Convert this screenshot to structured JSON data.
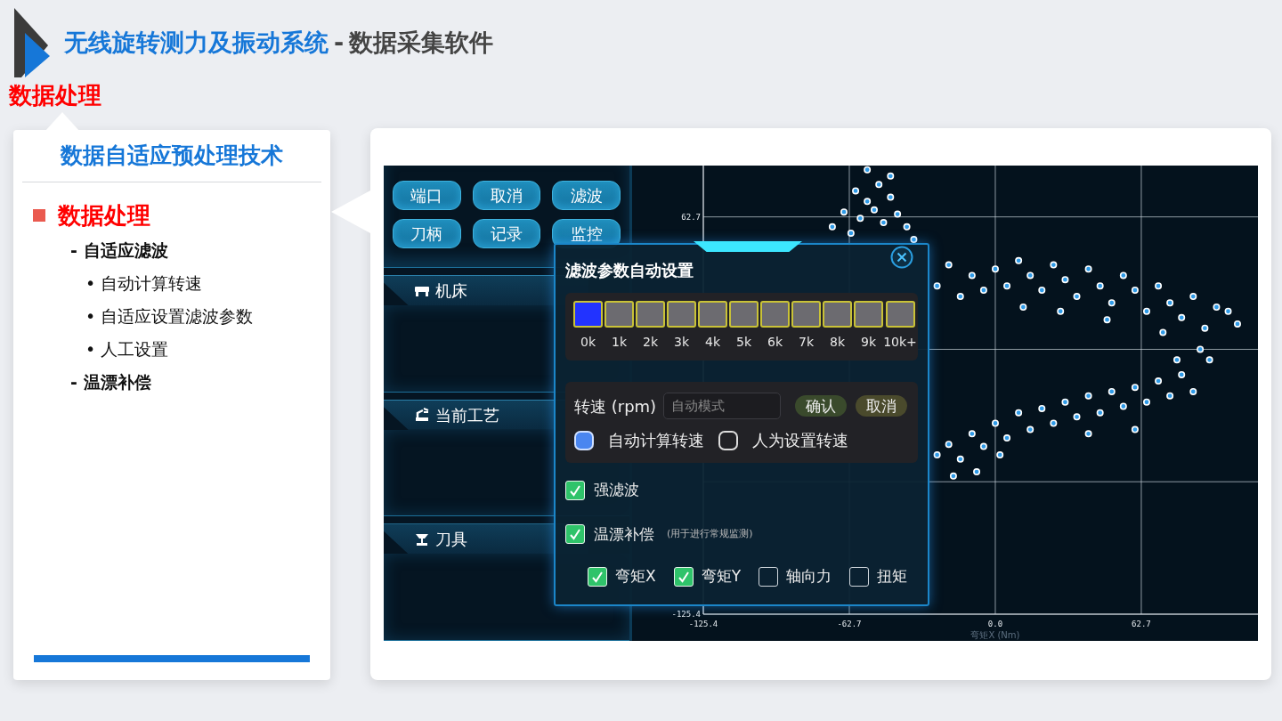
{
  "header": {
    "title_main": "无线旋转测力及振动系统",
    "title_separator": "-",
    "title_sub": "数据采集软件",
    "section": "数据处理"
  },
  "outline": {
    "title": "数据自适应预处理技术",
    "items": [
      {
        "text": "数据处理",
        "children": [
          {
            "marker": "-",
            "text": "自适应滤波",
            "children": [
              {
                "marker": "•",
                "text": "自动计算转速"
              },
              {
                "marker": "•",
                "text": "自适应设置滤波参数"
              },
              {
                "marker": "•",
                "text": "人工设置"
              }
            ]
          },
          {
            "marker": "-",
            "text": "温漂补偿"
          }
        ]
      }
    ]
  },
  "app": {
    "toolbar_buttons": [
      "端口",
      "取消",
      "滤波",
      "刀柄",
      "记录",
      "监控"
    ],
    "panels": [
      {
        "title": "机床",
        "kind": "machine"
      },
      {
        "title": "当前工艺",
        "kind": "process"
      },
      {
        "title": "刀具",
        "kind": "tool"
      }
    ],
    "dialog": {
      "title": "滤波参数自动设置",
      "speed_bins": [
        {
          "label": "0k",
          "selected": true
        },
        {
          "label": "1k",
          "selected": false
        },
        {
          "label": "2k",
          "selected": false
        },
        {
          "label": "3k",
          "selected": false
        },
        {
          "label": "4k",
          "selected": false
        },
        {
          "label": "5k",
          "selected": false
        },
        {
          "label": "6k",
          "selected": false
        },
        {
          "label": "7k",
          "selected": false
        },
        {
          "label": "8k",
          "selected": false
        },
        {
          "label": "9k",
          "selected": false
        },
        {
          "label": "10k+",
          "selected": false
        }
      ],
      "speed_label": "转速 (rpm)",
      "speed_placeholder": "自动模式",
      "confirm": "确认",
      "cancel": "取消",
      "speed_modes": [
        {
          "label": "自动计算转速",
          "selected": true
        },
        {
          "label": "人为设置转速",
          "selected": false
        }
      ],
      "options": [
        {
          "label": "强滤波",
          "checked": true
        },
        {
          "label": "温漂补偿",
          "note": "(用于进行常规监测)",
          "checked": true
        }
      ],
      "channels": [
        {
          "label": "弯矩X",
          "checked": true
        },
        {
          "label": "弯矩Y",
          "checked": true
        },
        {
          "label": "轴向力",
          "checked": false
        },
        {
          "label": "扭矩",
          "checked": false
        }
      ]
    },
    "plot": {
      "chart_data": {
        "type": "scatter",
        "xlabel": "弯矩X (Nm)",
        "xlim": [
          -125.4,
          112.8
        ],
        "ylim": [
          -125.4,
          87
        ],
        "grid": true,
        "xticks": [
          -125.4,
          -62.7,
          {
            "value": 0,
            "label": "0.0"
          },
          62.7
        ],
        "yticks": [
          -125.4,
          62.7
        ],
        "x": [
          -60,
          -55,
          -50,
          -45,
          -65,
          -58,
          -52,
          -48,
          -42,
          -38,
          -70,
          -62,
          -35,
          -55,
          -45,
          -20,
          -10,
          0,
          5,
          10,
          15,
          20,
          25,
          30,
          35,
          40,
          45,
          50,
          55,
          60,
          65,
          70,
          75,
          80,
          85,
          90,
          95,
          -25,
          -15,
          -5,
          12,
          28,
          48,
          72,
          100,
          104,
          88,
          92,
          -25,
          -20,
          -15,
          -10,
          -5,
          0,
          5,
          10,
          15,
          20,
          25,
          30,
          35,
          40,
          45,
          50,
          55,
          60,
          65,
          70,
          75,
          80,
          85,
          -18,
          -8,
          2,
          40,
          60,
          78
        ],
        "series": [
          {
            "color": "#2f9be8",
            "values": [
              75,
              70,
              78,
              72,
              65,
              62,
              66,
              60,
              64,
              58,
              58,
              55,
              52,
              85,
              82,
              40,
              35,
              38,
              30,
              42,
              35,
              28,
              40,
              33,
              25,
              38,
              30,
              22,
              35,
              28,
              18,
              30,
              22,
              15,
              25,
              10,
              20,
              30,
              25,
              28,
              20,
              18,
              14,
              8,
              18,
              12,
              0,
              -5,
              -50,
              -45,
              -52,
              -40,
              -46,
              -35,
              -42,
              -30,
              -38,
              -28,
              -35,
              -25,
              -32,
              -22,
              -30,
              -20,
              -27,
              -18,
              -25,
              -15,
              -22,
              -12,
              -20,
              -60,
              -58,
              -50,
              -40,
              -38,
              -5
            ]
          }
        ]
      }
    }
  }
}
